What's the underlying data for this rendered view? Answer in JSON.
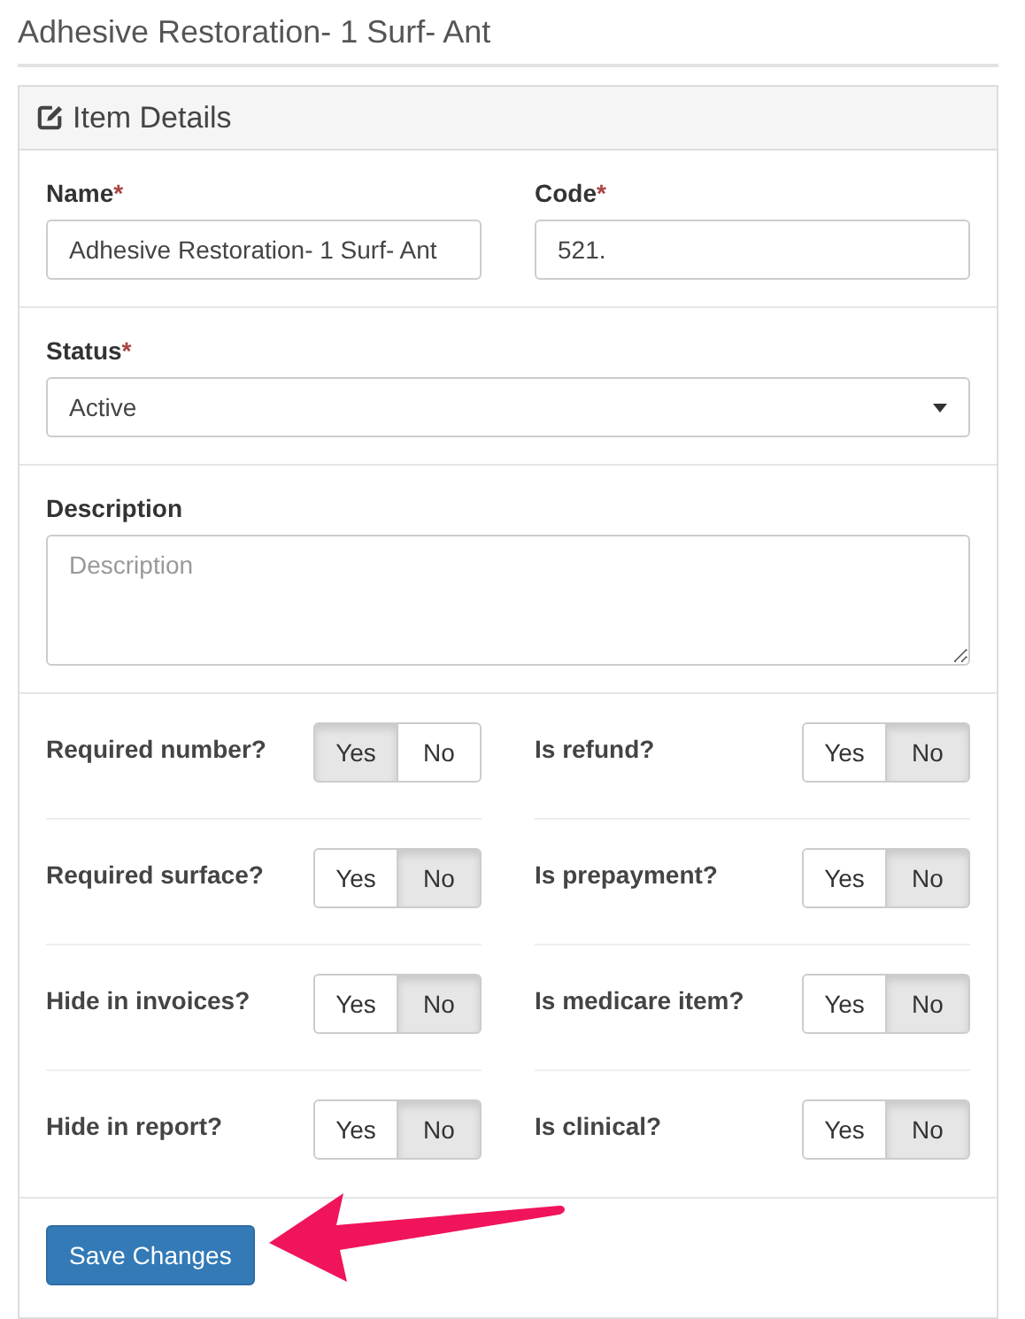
{
  "page_title": "Adhesive Restoration- 1 Surf- Ant",
  "panel": {
    "title": "Item Details"
  },
  "fields": [
    {
      "label": "Name",
      "required_mark": "*",
      "value": "Adhesive Restoration- 1 Surf- Ant"
    },
    {
      "label": "Code",
      "required_mark": "*",
      "value": "521."
    }
  ],
  "status": {
    "label": "Status",
    "required_mark": "*",
    "value": "Active"
  },
  "description": {
    "label": "Description",
    "placeholder": "Description"
  },
  "toggles": [
    {
      "label": "Required number?",
      "options": [
        {
          "label": "Yes",
          "selected": true
        },
        {
          "label": "No",
          "selected": false
        }
      ]
    },
    {
      "label": "Is refund?",
      "options": [
        {
          "label": "Yes",
          "selected": false
        },
        {
          "label": "No",
          "selected": true
        }
      ]
    },
    {
      "label": "Required surface?",
      "options": [
        {
          "label": "Yes",
          "selected": false
        },
        {
          "label": "No",
          "selected": true
        }
      ]
    },
    {
      "label": "Is prepayment?",
      "options": [
        {
          "label": "Yes",
          "selected": false
        },
        {
          "label": "No",
          "selected": true
        }
      ]
    },
    {
      "label": "Hide in invoices?",
      "options": [
        {
          "label": "Yes",
          "selected": false
        },
        {
          "label": "No",
          "selected": true
        }
      ]
    },
    {
      "label": "Is medicare item?",
      "options": [
        {
          "label": "Yes",
          "selected": false
        },
        {
          "label": "No",
          "selected": true
        }
      ]
    },
    {
      "label": "Hide in report?",
      "options": [
        {
          "label": "Yes",
          "selected": false
        },
        {
          "label": "No",
          "selected": true
        }
      ]
    },
    {
      "label": "Is clinical?",
      "options": [
        {
          "label": "Yes",
          "selected": false
        },
        {
          "label": "No",
          "selected": true
        }
      ]
    }
  ],
  "save_button": "Save Changes"
}
